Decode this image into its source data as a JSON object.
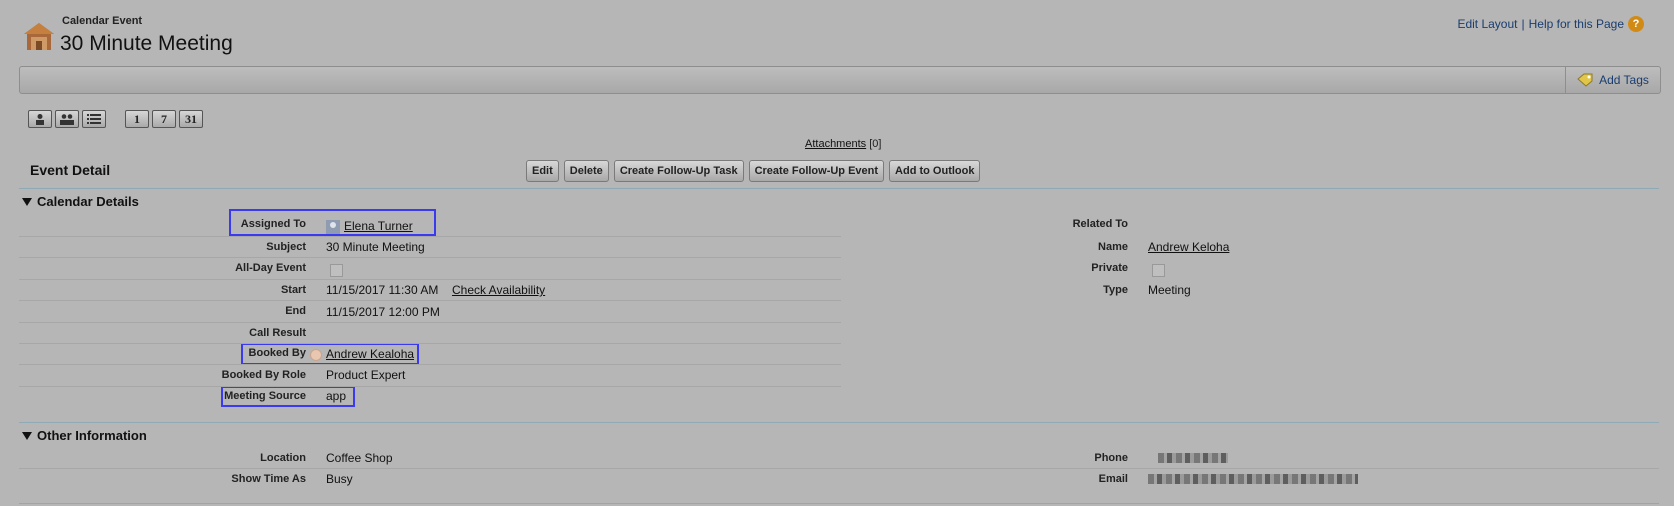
{
  "header": {
    "object_type": "Calendar Event",
    "title": "30 Minute Meeting",
    "edit_layout": "Edit Layout",
    "separator": "|",
    "help": "Help for this Page"
  },
  "tagbar": {
    "add_tags": "Add Tags"
  },
  "calendar_views": {
    "days": [
      "1",
      "7",
      "31"
    ]
  },
  "attachments": {
    "label": "Attachments",
    "count": "[0]"
  },
  "detail": {
    "title": "Event Detail",
    "buttons": [
      "Edit",
      "Delete",
      "Create Follow-Up Task",
      "Create Follow-Up Event",
      "Add to Outlook"
    ]
  },
  "calendar_details": {
    "title": "Calendar Details",
    "assigned_to_label": "Assigned To",
    "assigned_to_value": "Elena Turner",
    "subject_label": "Subject",
    "subject_value": "30 Minute Meeting",
    "all_day_label": "All-Day Event",
    "start_label": "Start",
    "start_value": "11/15/2017 11:30 AM",
    "check_availability": "Check Availability",
    "end_label": "End",
    "end_value": "11/15/2017 12:00 PM",
    "call_result_label": "Call Result",
    "booked_by_label": "Booked By",
    "booked_by_value": "Andrew Kealoha",
    "booked_by_role_label": "Booked By Role",
    "booked_by_role_value": "Product Expert",
    "meeting_source_label": "Meeting Source",
    "meeting_source_value": "app",
    "related_to_label": "Related To",
    "name_label": "Name",
    "name_value": "Andrew Keloha",
    "private_label": "Private",
    "type_label": "Type",
    "type_value": "Meeting"
  },
  "other_info": {
    "title": "Other Information",
    "location_label": "Location",
    "location_value": "Coffee Shop",
    "show_time_label": "Show Time As",
    "show_time_value": "Busy",
    "phone_label": "Phone",
    "email_label": "Email"
  }
}
